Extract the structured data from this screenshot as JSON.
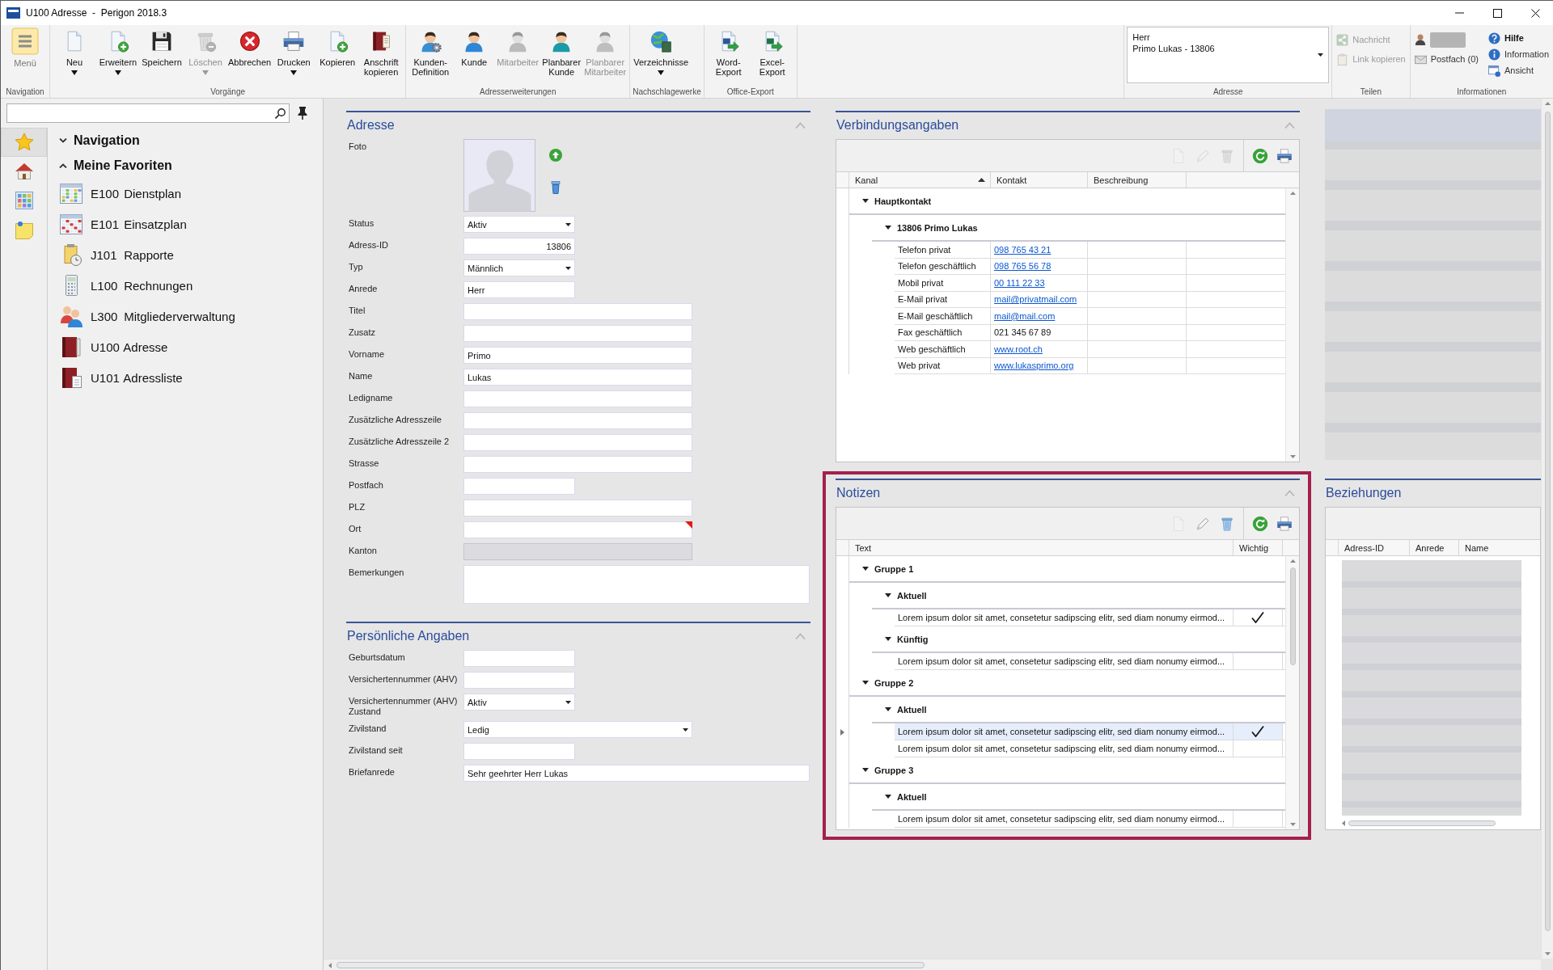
{
  "window": {
    "title": "U100 Adresse  -  Perigon 2018.3"
  },
  "ribbon": {
    "groups": [
      {
        "label": "Navigation",
        "buttons": [
          {
            "kind": "menu",
            "label": "Menü",
            "disabled": false,
            "dropdown": false
          }
        ]
      },
      {
        "label": "Vorgänge",
        "buttons": [
          {
            "kind": "large",
            "label": "Neu",
            "disabled": false,
            "dropdown": true
          },
          {
            "kind": "large",
            "label": "Erweitern",
            "disabled": false,
            "dropdown": true
          },
          {
            "kind": "large",
            "label": "Speichern",
            "disabled": false,
            "dropdown": false
          },
          {
            "kind": "large",
            "label": "Löschen",
            "disabled": true,
            "dropdown": true
          },
          {
            "kind": "large",
            "label": "Abbrechen",
            "disabled": false,
            "dropdown": false
          },
          {
            "kind": "large",
            "label": "Drucken",
            "disabled": false,
            "dropdown": true
          },
          {
            "kind": "large",
            "label": "Kopieren",
            "disabled": false,
            "dropdown": false
          },
          {
            "kind": "large",
            "label": "Anschrift kopieren",
            "disabled": false,
            "dropdown": false
          }
        ]
      },
      {
        "label": "Adresserweiterungen",
        "buttons": [
          {
            "kind": "large",
            "label": "Kunden-Definition",
            "disabled": false,
            "dropdown": false
          },
          {
            "kind": "large",
            "label": "Kunde",
            "disabled": false,
            "dropdown": false
          },
          {
            "kind": "large",
            "label": "Mitarbeiter",
            "disabled": true,
            "dropdown": false
          },
          {
            "kind": "large",
            "label": "Planbarer Kunde",
            "disabled": false,
            "dropdown": false
          },
          {
            "kind": "large",
            "label": "Planbarer Mitarbeiter",
            "disabled": true,
            "dropdown": false
          }
        ]
      },
      {
        "label": "Nachschlagewerke",
        "buttons": [
          {
            "kind": "large",
            "label": "Verzeichnisse",
            "disabled": false,
            "dropdown": true
          }
        ]
      },
      {
        "label": "Office-Export",
        "buttons": [
          {
            "kind": "large",
            "label": "Word-Export",
            "disabled": false,
            "dropdown": false
          },
          {
            "kind": "large",
            "label": "Excel-Export",
            "disabled": false,
            "dropdown": false
          }
        ]
      },
      {
        "label": "Adresse",
        "buttons": [
          {
            "kind": "combo",
            "lines": [
              "Herr",
              "Primo Lukas - 13806"
            ]
          }
        ]
      },
      {
        "label": "Teilen",
        "columns": [
          [
            {
              "kind": "small",
              "label": "Nachricht",
              "disabled": true,
              "emphasized": false
            },
            {
              "kind": "small",
              "label": "Link kopieren",
              "disabled": true,
              "emphasized": false
            }
          ]
        ]
      },
      {
        "label": "Informationen",
        "columns": [
          [
            {
              "kind": "user"
            },
            {
              "kind": "small",
              "label": "Postfach (0)",
              "disabled": false,
              "emphasized": false
            }
          ],
          [
            {
              "kind": "small",
              "label": "Hilfe",
              "disabled": false,
              "emphasized": true
            },
            {
              "kind": "small",
              "label": "Information",
              "disabled": false,
              "emphasized": false
            },
            {
              "kind": "small",
              "label": "Ansicht",
              "disabled": false,
              "emphasized": false
            }
          ]
        ]
      }
    ]
  },
  "navigation": {
    "rail": [
      {
        "selected": true
      },
      {
        "selected": false
      },
      {
        "selected": false
      },
      {
        "selected": false
      }
    ],
    "tree": [
      {
        "label": "Navigation",
        "expanded": false
      },
      {
        "label": "Meine Favoriten",
        "expanded": true,
        "children": [
          {
            "code": "E100",
            "label": "Dienstplan"
          },
          {
            "code": "E101",
            "label": "Einsatzplan"
          },
          {
            "code": "J101",
            "label": "Rapporte"
          },
          {
            "code": "L100",
            "label": "Rechnungen"
          },
          {
            "code": "L300",
            "label": "Mitgliederverwaltung"
          },
          {
            "code": "U100",
            "label": "Adresse"
          },
          {
            "code": "U101",
            "label": "Adressliste"
          }
        ]
      }
    ]
  },
  "address": {
    "title": "Adresse",
    "expanded": true,
    "fields": [
      {
        "label": "Foto",
        "kind": "photo"
      },
      {
        "label": "Status",
        "kind": "dropdown",
        "value": "Aktiv",
        "disabled": false,
        "flagged": false
      },
      {
        "label": "Adress-ID",
        "kind": "number",
        "value": "13806",
        "disabled": false,
        "flagged": false
      },
      {
        "label": "Typ",
        "kind": "dropdown",
        "value": "Männlich",
        "disabled": false,
        "flagged": false
      },
      {
        "label": "Anrede",
        "kind": "text",
        "value": "Herr",
        "disabled": false,
        "flagged": false
      },
      {
        "label": "Titel",
        "kind": "text",
        "disabled": false,
        "flagged": false
      },
      {
        "label": "Zusatz",
        "kind": "text",
        "disabled": false,
        "flagged": false
      },
      {
        "label": "Vorname",
        "kind": "text",
        "value": "Primo",
        "disabled": false,
        "flagged": false
      },
      {
        "label": "Name",
        "kind": "text",
        "value": "Lukas",
        "disabled": false,
        "flagged": false
      },
      {
        "label": "Ledigname",
        "kind": "text",
        "disabled": false,
        "flagged": false
      },
      {
        "label": "Zusätzliche Adresszeile",
        "kind": "text",
        "disabled": false,
        "flagged": false
      },
      {
        "label": "Zusätzliche Adresszeile 2",
        "kind": "text",
        "disabled": false,
        "flagged": false
      },
      {
        "label": "Strasse",
        "kind": "text",
        "disabled": false,
        "flagged": false
      },
      {
        "label": "Postfach",
        "kind": "text",
        "disabled": false,
        "flagged": false
      },
      {
        "label": "PLZ",
        "kind": "text",
        "disabled": false,
        "flagged": false
      },
      {
        "label": "Ort",
        "kind": "text",
        "disabled": false,
        "flagged": true
      },
      {
        "label": "Kanton",
        "kind": "text",
        "disabled": true,
        "flagged": false
      },
      {
        "label": "Bemerkungen",
        "kind": "memo",
        "disabled": false,
        "flagged": false
      }
    ]
  },
  "personal": {
    "title": "Persönliche Angaben",
    "expanded": true,
    "fields": [
      {
        "label": "Geburtsdatum",
        "kind": "text",
        "disabled": false,
        "flagged": false
      },
      {
        "label": "Versichertennummer (AHV)",
        "kind": "text",
        "disabled": false,
        "flagged": false
      },
      {
        "label": "Versichertennummer (AHV) Zustand",
        "kind": "dropdown",
        "value": "Aktiv",
        "disabled": false,
        "flagged": false
      },
      {
        "label": "Zivilstand",
        "kind": "dropdown",
        "value": "Ledig",
        "disabled": false,
        "flagged": false
      },
      {
        "label": "Zivilstand seit",
        "kind": "text",
        "disabled": false,
        "flagged": false
      },
      {
        "label": "Briefanrede",
        "kind": "text",
        "value": "Sehr geehrter Herr Lukas",
        "disabled": false,
        "flagged": false
      }
    ]
  },
  "connections": {
    "title": "Verbindungsangaben",
    "expanded": true,
    "toolbar": [
      {
        "disabled": true
      },
      {
        "disabled": true
      },
      {
        "disabled": true
      },
      {
        "disabled": false
      },
      {
        "disabled": false
      }
    ],
    "columns": [
      {
        "label": "Kanal",
        "sorted": true
      },
      {
        "label": "Kontakt",
        "sorted": false
      },
      {
        "label": "Beschreibung",
        "sorted": false
      }
    ],
    "groups": [
      {
        "label": "Hauptkontakt",
        "expanded": true,
        "children": [
          {
            "label": "13806 Primo Lukas",
            "expanded": true,
            "rows": [
              {
                "cells": [
                  "Telefon privat",
                  "098 765 43 21"
                ],
                "link": true
              },
              {
                "cells": [
                  "Telefon geschäftlich",
                  "098 765 56 78"
                ],
                "link": true
              },
              {
                "cells": [
                  "Mobil privat",
                  "00 111 22 33"
                ],
                "link": true
              },
              {
                "cells": [
                  "E-Mail privat",
                  "mail@privatmail.com"
                ],
                "link": true
              },
              {
                "cells": [
                  "E-Mail geschäftlich",
                  "mail@mail.com"
                ],
                "link": true
              },
              {
                "cells": [
                  "Fax geschäftlich",
                  "021 345 67 89"
                ],
                "link": false
              },
              {
                "cells": [
                  "Web geschäftlich",
                  "www.root.ch"
                ],
                "link": true
              },
              {
                "cells": [
                  "Web privat",
                  "www.lukasprimo.org"
                ],
                "link": true
              }
            ]
          }
        ]
      }
    ]
  },
  "notes": {
    "title": "Notizen",
    "highlighted": true,
    "expanded": true,
    "toolbar": [
      {
        "disabled": true
      },
      {
        "disabled": false
      },
      {
        "disabled": false
      },
      {
        "disabled": false
      },
      {
        "disabled": false
      }
    ],
    "columns": [
      {
        "label": "Text"
      },
      {
        "label": "Wichtig"
      }
    ],
    "groups": [
      {
        "label": "Gruppe 1",
        "expanded": true,
        "children": [
          {
            "label": "Aktuell",
            "expanded": true,
            "rows": [
              {
                "text": "Lorem ipsum dolor sit amet, consetetur sadipscing elitr, sed diam nonumy eirmod...",
                "important": true,
                "selected": false
              }
            ]
          },
          {
            "label": "Künftig",
            "expanded": true,
            "rows": [
              {
                "text": "Lorem ipsum dolor sit amet, consetetur sadipscing elitr, sed diam nonumy eirmod...",
                "important": false,
                "selected": false
              }
            ]
          }
        ]
      },
      {
        "label": "Gruppe 2",
        "expanded": true,
        "children": [
          {
            "label": "Aktuell",
            "expanded": true,
            "rows": [
              {
                "text": "Lorem ipsum dolor sit amet, consetetur sadipscing elitr, sed diam nonumy eirmod...",
                "important": true,
                "selected": true
              },
              {
                "text": "Lorem ipsum dolor sit amet, consetetur sadipscing elitr, sed diam nonumy eirmod...",
                "important": false,
                "selected": false
              }
            ]
          }
        ]
      },
      {
        "label": "Gruppe 3",
        "expanded": true,
        "children": [
          {
            "label": "Aktuell",
            "expanded": true,
            "rows": [
              {
                "text": "Lorem ipsum dolor sit amet, consetetur sadipscing elitr, sed diam nonumy eirmod...",
                "important": false,
                "selected": false
              }
            ]
          }
        ]
      }
    ]
  },
  "relations": {
    "title": "Beziehungen",
    "columns": [
      {
        "label": "Adress-ID"
      },
      {
        "label": "Anrede"
      },
      {
        "label": "Name"
      }
    ]
  }
}
